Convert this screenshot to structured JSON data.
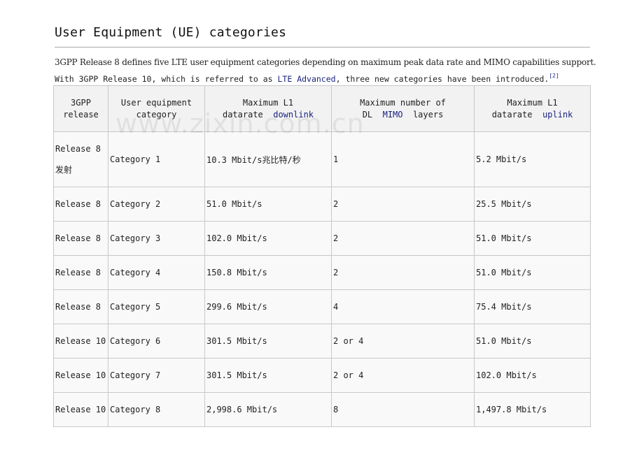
{
  "title": "User Equipment (UE) categories",
  "intro": {
    "line1": "3GPP Release 8 defines five LTE user equipment categories depending on maximum peak data rate and MIMO capabilities support.",
    "line2_prefix": "With 3GPP Release 10, which is referred to as ",
    "line2_link": "LTE Advanced",
    "line2_suffix": ", three new categories have been introduced.",
    "ref": "[2]"
  },
  "watermark": "www.zixin.com.cn",
  "table": {
    "headers": {
      "release_1": "3GPP",
      "release_2": "release",
      "category_1": "User equipment",
      "category_2": "category",
      "downlink_1": "Maximum L1",
      "downlink_2": "datarate",
      "downlink_link": "downlink",
      "mimo_1": "Maximum number of",
      "mimo_2a": "DL",
      "mimo_link": "MIMO",
      "mimo_2b": "layers",
      "uplink_1": "Maximum L1",
      "uplink_2": "datarate",
      "uplink_link": "uplink"
    },
    "rows": [
      {
        "release": "Release 8",
        "release_note": "发射",
        "category": "Category 1",
        "downlink": "10.3 Mbit/s兆比特/秒",
        "mimo": "1",
        "uplink": "5.2 Mbit/s"
      },
      {
        "release": "Release 8",
        "category": "Category 2",
        "downlink": "51.0 Mbit/s",
        "mimo": "2",
        "uplink": "25.5 Mbit/s"
      },
      {
        "release": "Release 8",
        "category": "Category 3",
        "downlink": "102.0 Mbit/s",
        "mimo": "2",
        "uplink": "51.0 Mbit/s"
      },
      {
        "release": "Release 8",
        "category": "Category 4",
        "downlink": "150.8 Mbit/s",
        "mimo": "2",
        "uplink": "51.0 Mbit/s"
      },
      {
        "release": "Release 8",
        "category": "Category 5",
        "downlink": "299.6 Mbit/s",
        "mimo": "4",
        "uplink": "75.4 Mbit/s"
      },
      {
        "release": "Release 10",
        "category": "Category 6",
        "downlink": "301.5 Mbit/s",
        "mimo": "2 or 4",
        "uplink": "51.0 Mbit/s"
      },
      {
        "release": "Release 10",
        "category": "Category 7",
        "downlink": "301.5 Mbit/s",
        "mimo": "2 or 4",
        "uplink": "102.0 Mbit/s"
      },
      {
        "release": "Release 10",
        "category": "Category 8",
        "downlink": "2,998.6 Mbit/s",
        "mimo": "8",
        "uplink": "1,497.8 Mbit/s"
      }
    ]
  }
}
